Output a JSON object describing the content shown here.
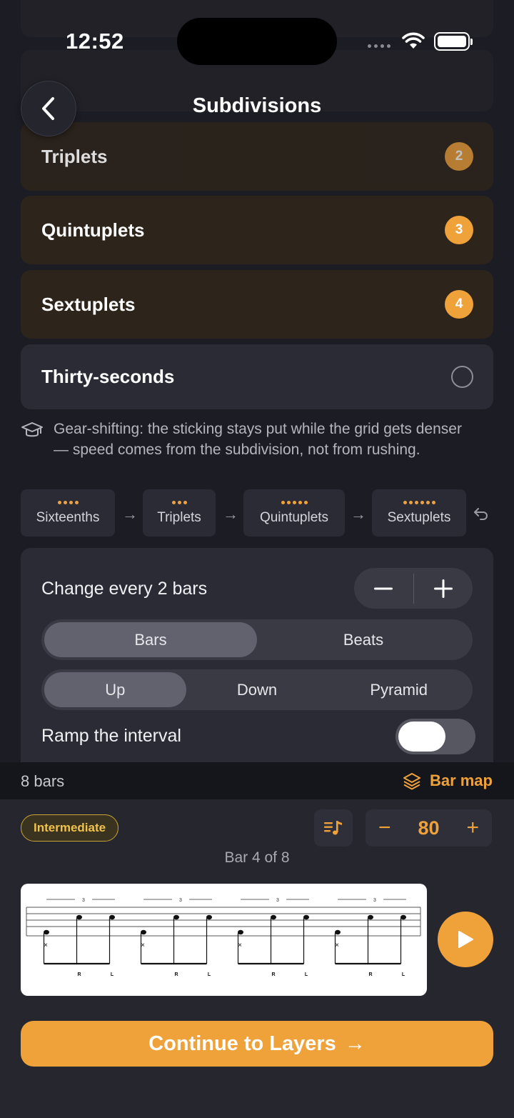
{
  "status_bar": {
    "time": "12:52"
  },
  "header": {
    "title": "Subdivisions"
  },
  "list": [
    {
      "label": "Triplets",
      "badge": "2",
      "state": "done"
    },
    {
      "label": "Quintuplets",
      "badge": "3",
      "state": "done"
    },
    {
      "label": "Sextuplets",
      "badge": "4",
      "state": "done"
    },
    {
      "label": "Thirty-seconds",
      "badge": "",
      "state": "todo"
    }
  ],
  "hint": {
    "icon": "graduation-cap-icon",
    "text": "Gear-shifting: the sticking stays put while the grid gets denser — speed comes from the subdivision, not from rushing."
  },
  "chain": [
    {
      "label": "Sixteenths",
      "dots": 4
    },
    {
      "label": "Triplets",
      "dots": 3
    },
    {
      "label": "Quintuplets",
      "dots": 5
    },
    {
      "label": "Sextuplets",
      "dots": 6
    }
  ],
  "settings": {
    "change_label": "Change every 2 bars",
    "unit_options": [
      "Bars",
      "Beats"
    ],
    "unit_selected": "Bars",
    "direction_options": [
      "Up",
      "Down",
      "Pyramid"
    ],
    "direction_selected": "Up",
    "ramp_label": "Ramp the interval",
    "ramp_on": false
  },
  "summary": {
    "bars": "8 bars",
    "bar_map_label": "Bar map"
  },
  "player": {
    "level": "Intermediate",
    "tempo": "80",
    "bar_position": "Bar 4 of 8",
    "tuplet_label": "3",
    "sticking": [
      "R",
      "L",
      "R",
      "L",
      "R",
      "L",
      "R",
      "L"
    ]
  },
  "cta": {
    "label": "Continue to Layers",
    "arrow": "→"
  },
  "colors": {
    "accent": "#f0a23a",
    "background": "#1c1c24",
    "card": "#2b2b36",
    "card_done": "#2d241b"
  }
}
